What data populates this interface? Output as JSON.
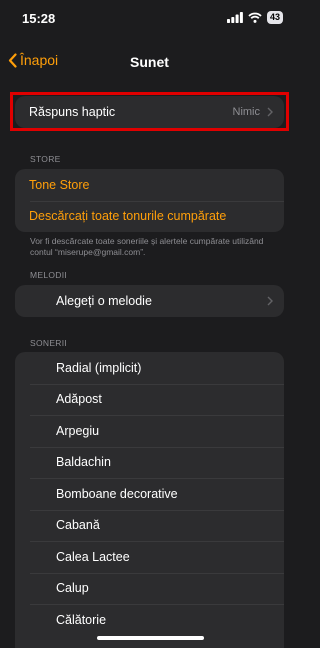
{
  "status": {
    "time": "15:28",
    "battery": "43"
  },
  "nav": {
    "back_label": "Înapoi",
    "title": "Sunet"
  },
  "haptic": {
    "label": "Răspuns haptic",
    "value": "Nimic"
  },
  "store": {
    "header": "STORE",
    "items": [
      "Tone Store",
      "Descărcați toate tonurile cumpărate"
    ],
    "footer": "Vor fi descărcate toate soneriile și alertele cumpărate utilizând contul “miserupe@gmail.com”."
  },
  "melodii": {
    "header": "MELODII",
    "item": "Alegeți o melodie"
  },
  "sonerii": {
    "header": "SONERII",
    "items": [
      "Radial (implicit)",
      "Adăpost",
      "Arpegiu",
      "Baldachin",
      "Bomboane decorative",
      "Cabană",
      "Calea Lactee",
      "Calup",
      "Călătorie"
    ]
  },
  "colors": {
    "accent": "#ff9f0a",
    "highlight_border": "#e00000"
  },
  "icons": {
    "back": "chevron-left-icon",
    "chevron": "chevron-right-icon"
  }
}
